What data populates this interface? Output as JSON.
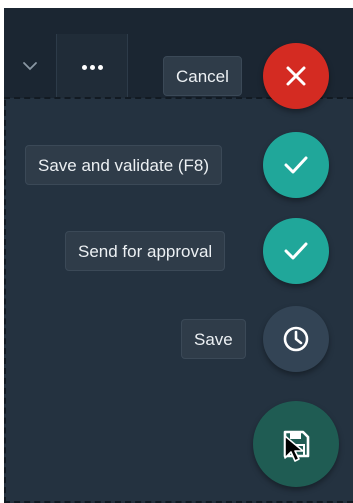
{
  "actions": {
    "cancel_label": "Cancel",
    "save_validate_label": "Save and validate (F8)",
    "send_approval_label": "Send for approval",
    "save_label": "Save"
  },
  "icons": {
    "toolbar_dropdown": "chevron-down-icon",
    "toolbar_more": "more-horizontal-icon",
    "cancel": "close-icon",
    "save_validate": "check-icon",
    "send_approval": "check-icon",
    "save": "clock-icon",
    "main": "floppy-disk-icon",
    "cursor": "mouse-pointer-icon"
  },
  "colors": {
    "panel_bg": "#243240",
    "topbar_bg": "#1b2632",
    "cancel": "#d42b22",
    "confirm": "#20a79a",
    "clock": "#334455",
    "main_fab": "#1f5c53"
  }
}
